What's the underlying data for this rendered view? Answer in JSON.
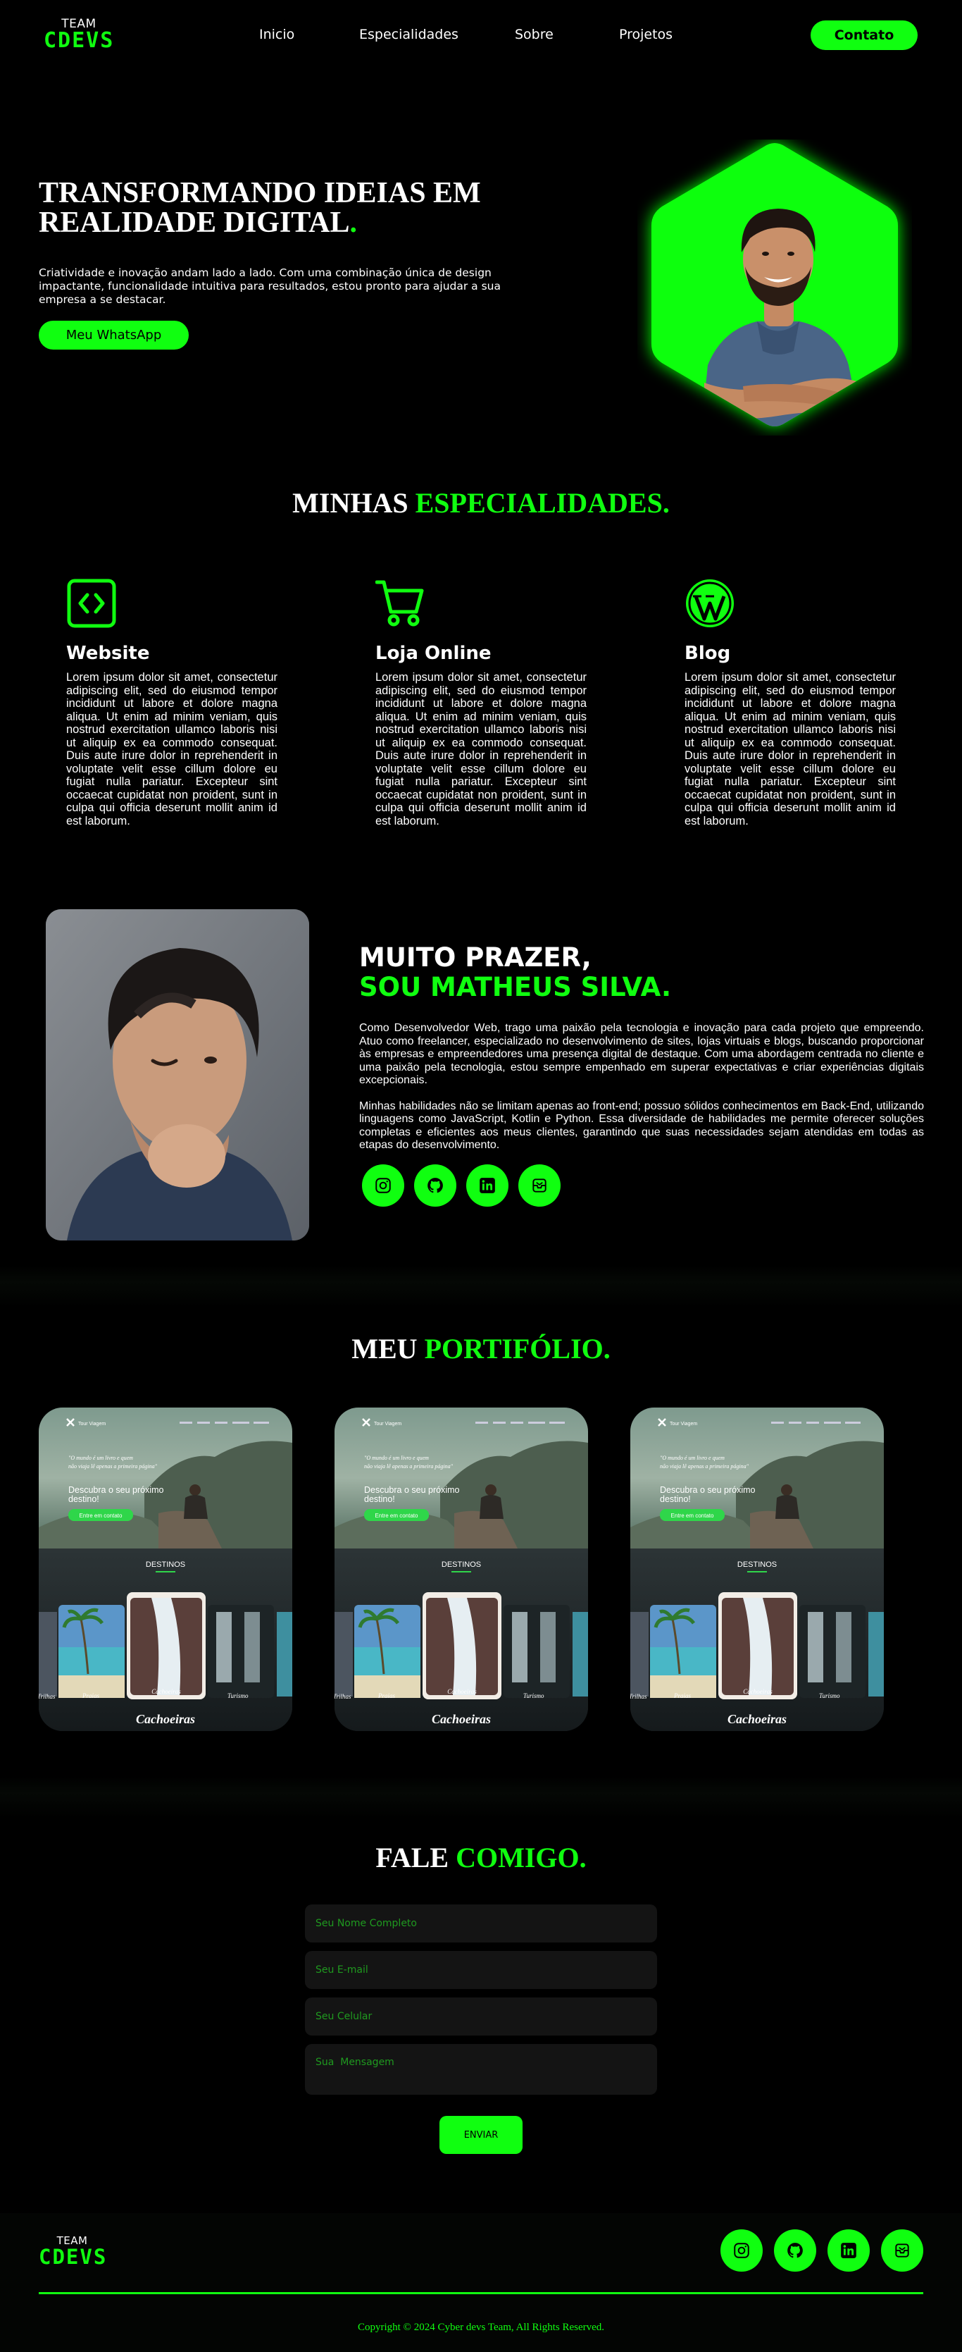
{
  "nav": {
    "logo_top": "TEAM",
    "logo_bottom": "CDEVS",
    "links": [
      "Inicio",
      "Especialidades",
      "Sobre",
      "Projetos"
    ],
    "cta": "Contato"
  },
  "hero": {
    "title_line1": "TRANSFORMANDO IDEIAS EM",
    "title_line2": "REALIDADE DIGITAL",
    "title_dot": ".",
    "subtitle": "Criatividade e inovação andam lado a lado. Com uma combinação única de design impactante, funcionalidade intuitiva para resultados, estou pronto para ajudar a sua empresa a se destacar.",
    "button": "Meu WhatsApp"
  },
  "specialties": {
    "title_white": "MINHAS",
    "title_green": "ESPECIALIDADES.",
    "items": [
      {
        "icon": "code-icon",
        "title": "Website",
        "text": "Lorem ipsum dolor sit amet, consectetur adipiscing elit, sed do eiusmod tempor incididunt ut labore et dolore magna aliqua. Ut enim ad minim veniam, quis nostrud exercitation ullamco laboris nisi ut aliquip ex ea commodo consequat. Duis aute irure dolor in reprehenderit in voluptate velit esse cillum dolore eu fugiat nulla pariatur. Excepteur sint occaecat cupidatat non proident, sunt in culpa qui officia deserunt mollit anim id est laborum."
      },
      {
        "icon": "cart-icon",
        "title": "Loja Online",
        "text": "Lorem ipsum dolor sit amet, consectetur adipiscing elit, sed do eiusmod tempor incididunt ut labore et dolore magna aliqua. Ut enim ad minim veniam, quis nostrud exercitation ullamco laboris nisi ut aliquip ex ea commodo consequat. Duis aute irure dolor in reprehenderit in voluptate velit esse cillum dolore eu fugiat nulla pariatur. Excepteur sint occaecat cupidatat non proident, sunt in culpa qui officia deserunt mollit anim id est laborum."
      },
      {
        "icon": "wordpress-icon",
        "title": "Blog",
        "text": "Lorem ipsum dolor sit amet, consectetur adipiscing elit, sed do eiusmod tempor incididunt ut labore et dolore magna aliqua. Ut enim ad minim veniam, quis nostrud exercitation ullamco laboris nisi ut aliquip ex ea commodo consequat. Duis aute irure dolor in reprehenderit in voluptate velit esse cillum dolore eu fugiat nulla pariatur. Excepteur sint occaecat cupidatat non proident, sunt in culpa qui officia deserunt mollit anim id est laborum."
      }
    ]
  },
  "about": {
    "title_line1": "MUITO PRAZER,",
    "title_line2": "SOU MATHEUS SILVA.",
    "paragraph1": "Como Desenvolvedor Web, trago uma paixão pela tecnologia e inovação para cada projeto que empreendo. Atuo como freelancer, especializado no desenvolvimento de sites, lojas virtuais e blogs, buscando proporcionar às empresas e empreendedores uma presença digital de destaque. Com uma abordagem centrada no cliente e uma paixão pela tecnologia, estou sempre empenhado em superar expectativas e criar experiências digitais excepcionais.",
    "paragraph2": "Minhas habilidades não se limitam apenas ao front-end; possuo sólidos conhecimentos em Back-End, utilizando linguagens como JavaScript, Kotlin e Python. Essa diversidade de habilidades me permite oferecer soluções completas e eficientes aos meus clientes, garantindo que suas necessidades sejam atendidas em todas as etapas do desenvolvimento.",
    "social": [
      "instagram-icon",
      "github-icon",
      "linkedin-icon",
      "mail-icon"
    ]
  },
  "portfolio": {
    "title_white": "MEU",
    "title_green": "PORTIFÓLIO.",
    "cards": [
      {
        "brand": "Tour Viagem",
        "quote1": "\"O mundo é um livro e quem",
        "quote2": "não viaja lê apenas a primeira página\"",
        "headline1": "Descubra o seu próximo",
        "headline2": "destino!",
        "button": "Entre em contato",
        "section": "DESTINOS",
        "tile_left": "Praias",
        "tile_center": "Cachoeiras",
        "tile_right": "Turismo",
        "tile_edge": "Trilhas",
        "caption": "Cachoeiras"
      },
      {
        "brand": "Tour Viagem",
        "quote1": "\"O mundo é um livro e quem",
        "quote2": "não viaja lê apenas a primeira página\"",
        "headline1": "Descubra o seu próximo",
        "headline2": "destino!",
        "button": "Entre em contato",
        "section": "DESTINOS",
        "tile_left": "Praias",
        "tile_center": "Cachoeiras",
        "tile_right": "Turismo",
        "tile_edge": "Trilhas",
        "caption": "Cachoeiras"
      },
      {
        "brand": "Tour Viagem",
        "quote1": "\"O mundo é um livro e quem",
        "quote2": "não viaja lê apenas a primeira página\"",
        "headline1": "Descubra o seu próximo",
        "headline2": "destino!",
        "button": "Entre em contato",
        "section": "DESTINOS",
        "tile_left": "Praias",
        "tile_center": "Cachoeiras",
        "tile_right": "Turismo",
        "tile_edge": "Trilhas",
        "caption": "Cachoeiras"
      }
    ]
  },
  "contact": {
    "title_white": "FALE",
    "title_green": "COMIGO.",
    "name_placeholder": "Seu Nome Completo",
    "email_placeholder": "Seu E-mail",
    "phone_placeholder": "Seu Celular",
    "message_placeholder": "Sua  Mensagem",
    "submit": "ENVIAR"
  },
  "footer": {
    "logo_top": "TEAM",
    "logo_bottom": "CDEVS",
    "copyright": "Copyright © 2024 Cyber devs Team, All Rights Reserved."
  },
  "colors": {
    "accent": "#10ff10",
    "background": "#000000",
    "field": "#141414"
  }
}
